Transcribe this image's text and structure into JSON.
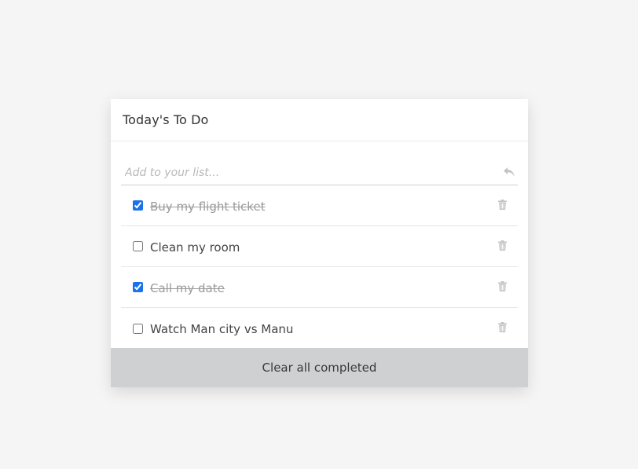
{
  "header": {
    "title": "Today's To Do"
  },
  "add": {
    "placeholder": "Add to your list...",
    "value": "",
    "submit_icon": "reply-icon"
  },
  "todos": [
    {
      "text": "Buy my flight ticket",
      "completed": true
    },
    {
      "text": "Clean my room",
      "completed": false
    },
    {
      "text": "Call my date",
      "completed": true
    },
    {
      "text": "Watch Man city vs Manu",
      "completed": false
    }
  ],
  "delete_icon": "trash-icon",
  "footer": {
    "clear_label": "Clear all completed"
  },
  "colors": {
    "page_background": "#f5f5f5",
    "card_background": "#ffffff",
    "footer_background": "#cfd0d2",
    "checkbox_accent": "#1a73e8",
    "completed_text": "#9a9a9a",
    "icon_color": "#c4c4c4"
  }
}
